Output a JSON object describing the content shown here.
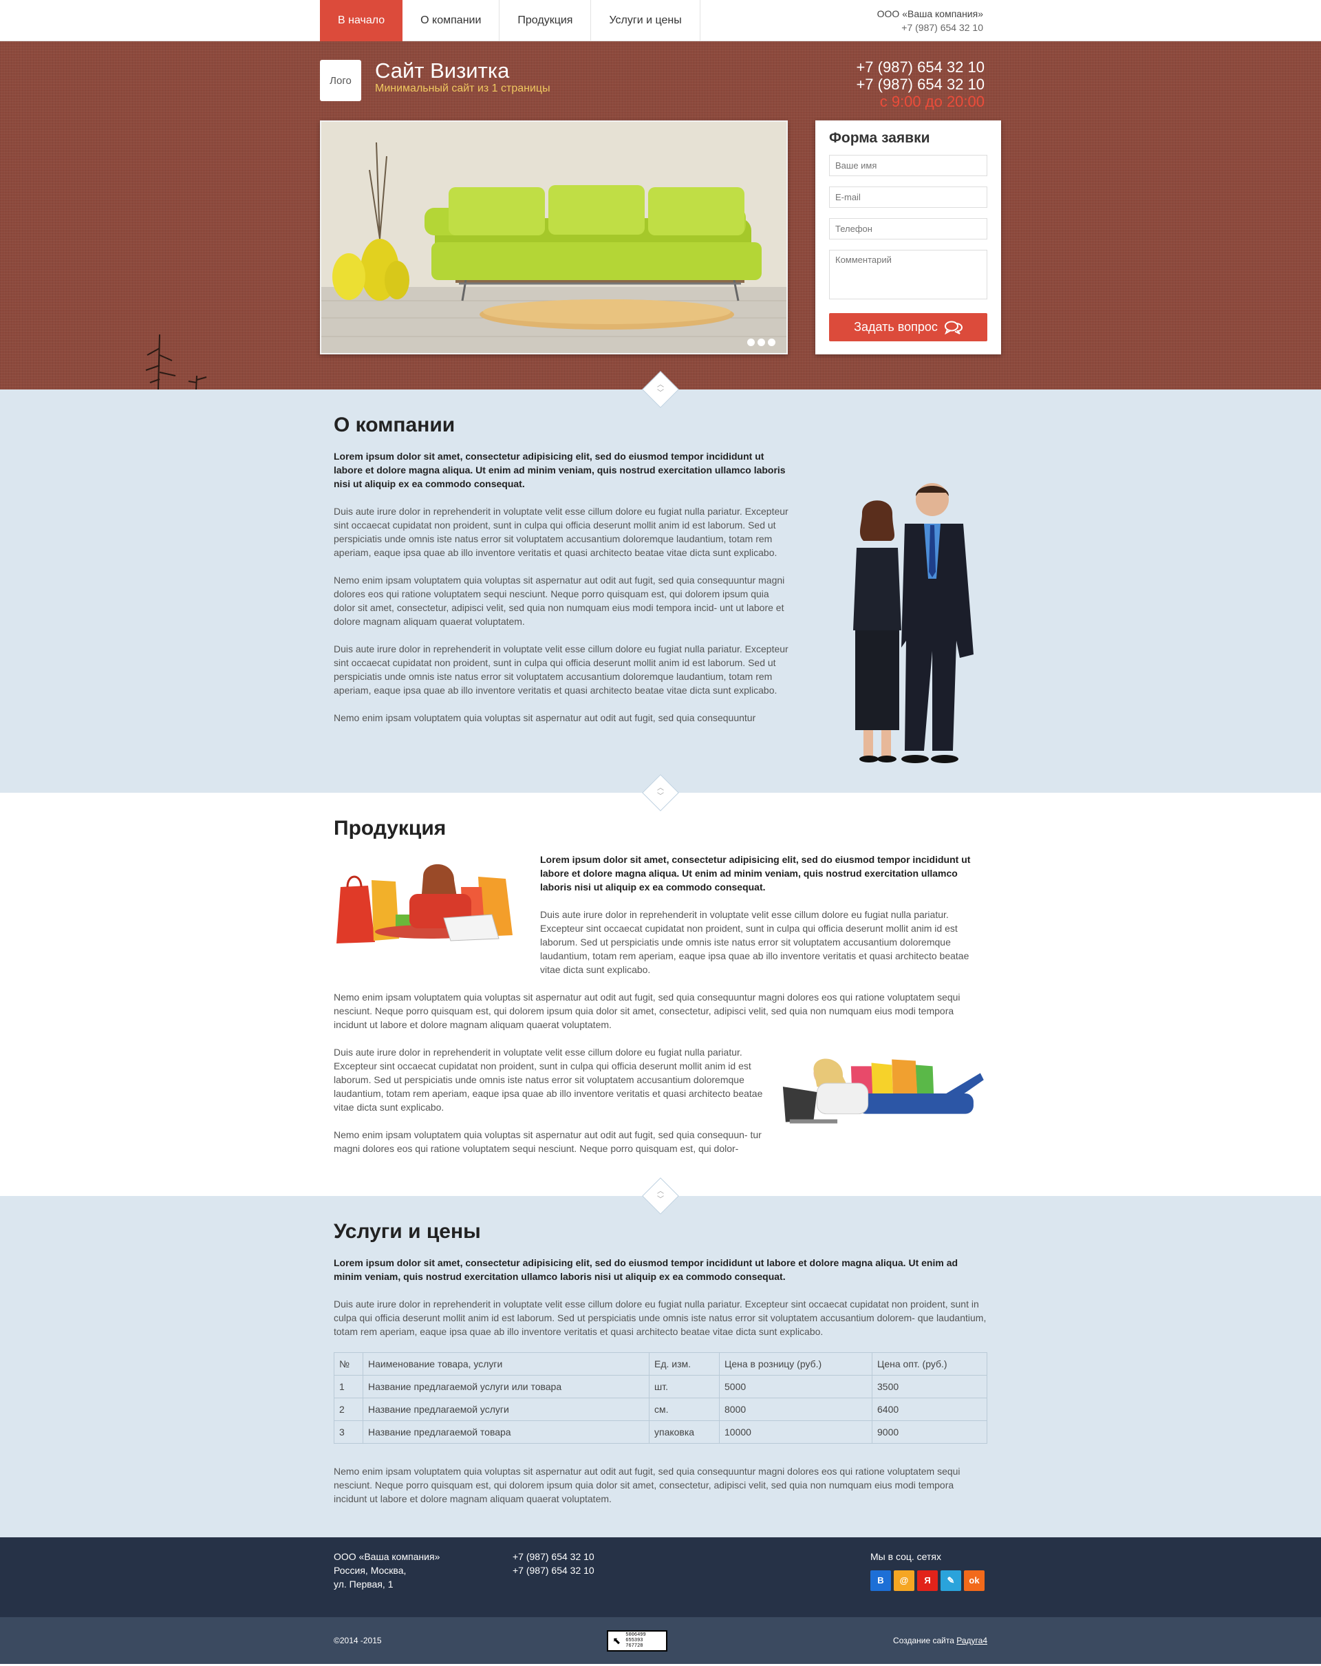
{
  "nav": {
    "items": [
      "В начало",
      "О компании",
      "Продукция",
      "Услуги и цены"
    ],
    "company": "ООО «Ваша компания»",
    "phone": "+7 (987) 654 32 10"
  },
  "hero": {
    "logo": "Лого",
    "title": "Сайт Визитка",
    "subtitle": "Минимальный сайт из 1 страницы",
    "phone1": "+7 (987) 654 32 10",
    "phone2": "+7 (987) 654 32 10",
    "hours": "с 9:00 до 20:00",
    "slider_dots": 3
  },
  "form": {
    "title": "Форма заявки",
    "name_placeholder": "Ваше имя",
    "email_placeholder": "E-mail",
    "phone_placeholder": "Телефон",
    "comment_placeholder": "Комментарий",
    "submit": "Задать вопрос"
  },
  "about": {
    "title": "О компании",
    "lead": "Lorem ipsum dolor sit amet, consectetur adipisicing elit, sed do eiusmod tempor incididunt ut labore et dolore magna aliqua. Ut enim ad minim veniam, quis nostrud exercitation ullamco laboris nisi ut aliquip ex ea commodo consequat.",
    "p1": "Duis aute irure dolor in reprehenderit in voluptate velit esse cillum dolore eu fugiat nulla pariatur. Excepteur sint occaecat cupidatat non proident, sunt in culpa qui officia deserunt mollit anim id est laborum. Sed ut perspiciatis unde omnis iste natus error sit voluptatem accusantium doloremque laudantium, totam rem aperiam, eaque ipsa quae ab illo inventore veritatis et quasi architecto beatae vitae dicta sunt explicabo.",
    "p2": "Nemo enim ipsam voluptatem quia voluptas sit aspernatur aut odit aut fugit, sed quia consequuntur magni dolores eos qui ratione voluptatem sequi nesciunt. Neque porro quisquam est, qui dolorem ipsum quia dolor sit amet, consectetur, adipisci velit, sed quia non numquam eius modi tempora incid- unt ut labore et dolore magnam aliquam quaerat voluptatem.",
    "p3": "Duis aute irure dolor in reprehenderit in voluptate velit esse cillum dolore eu fugiat nulla pariatur. Excepteur sint occaecat cupidatat non proident, sunt in culpa qui officia deserunt mollit anim id est laborum. Sed ut perspiciatis unde omnis iste natus error sit voluptatem accusantium doloremque laudantium, totam rem aperiam, eaque ipsa quae ab illo inventore veritatis et quasi architecto beatae vitae dicta sunt explicabo.",
    "p4": "Nemo enim ipsam voluptatem quia voluptas sit aspernatur aut odit aut fugit, sed quia consequuntur"
  },
  "products": {
    "title": "Продукция",
    "lead": "Lorem ipsum dolor sit amet, consectetur adipisicing elit, sed do eiusmod tempor incididunt ut labore et dolore magna aliqua. Ut enim ad minim veniam, quis nostrud exercitation ullamco laboris nisi ut aliquip ex ea commodo consequat.",
    "p1": "Duis aute irure dolor in reprehenderit in voluptate velit esse cillum dolore eu fugiat nulla pariatur. Excepteur sint occaecat cupidatat non proident, sunt in culpa qui officia deserunt mollit anim id est laborum. Sed ut perspiciatis unde omnis iste natus error sit voluptatem accusantium doloremque laudantium, totam rem aperiam, eaque ipsa quae ab illo inventore veritatis et quasi architecto beatae vitae dicta sunt explicabo.",
    "p2": "Nemo enim ipsam voluptatem quia voluptas sit aspernatur aut odit aut fugit, sed quia consequuntur magni dolores eos qui ratione voluptatem sequi nesciunt. Neque porro quisquam est, qui dolorem ipsum quia dolor sit amet, consectetur, adipisci velit, sed quia non numquam eius modi tempora incidunt ut labore et dolore magnam aliquam quaerat voluptatem.",
    "p3": "Duis aute irure dolor in reprehenderit in voluptate velit esse cillum dolore eu fugiat nulla pariatur. Excepteur sint occaecat cupidatat non proident, sunt in culpa qui officia deserunt mollit anim id est laborum. Sed ut perspiciatis unde omnis iste natus error sit voluptatem accusantium doloremque laudantium, totam rem aperiam, eaque ipsa quae ab illo inventore veritatis et quasi architecto beatae vitae dicta sunt explicabo.",
    "p4": "Nemo enim ipsam voluptatem quia voluptas sit aspernatur aut odit aut fugit, sed quia consequun- tur magni dolores eos qui ratione voluptatem sequi nesciunt. Neque porro quisquam est, qui dolor-"
  },
  "services": {
    "title": "Услуги и цены",
    "lead": "Lorem ipsum dolor sit amet, consectetur adipisicing elit, sed do eiusmod tempor incididunt ut labore et dolore magna aliqua. Ut enim ad minim veniam, quis nostrud exercitation ullamco laboris nisi ut aliquip ex ea commodo consequat.",
    "p1": "Duis aute irure dolor in reprehenderit in voluptate velit esse cillum dolore eu fugiat nulla pariatur. Excepteur sint occaecat cupidatat non proident, sunt in culpa qui officia deserunt mollit anim id est laborum. Sed ut perspiciatis unde omnis iste natus error sit voluptatem accusantium dolorem- que laudantium, totam rem aperiam, eaque ipsa quae ab illo inventore veritatis et quasi architecto beatae vitae dicta sunt explicabo.",
    "table": {
      "headers": [
        "№",
        "Наименование товара, услуги",
        "Ед. изм.",
        "Цена в розницу (руб.)",
        "Цена опт. (руб.)"
      ],
      "rows": [
        [
          "1",
          "Название предлагаемой услуги или товара",
          "шт.",
          "5000",
          "3500"
        ],
        [
          "2",
          "Название предлагаемой услуги",
          "см.",
          "8000",
          "6400"
        ],
        [
          "3",
          "Название предлагаемой товара",
          "упаковка",
          "10000",
          "9000"
        ]
      ]
    },
    "p2": "Nemo enim ipsam voluptatem quia voluptas sit aspernatur aut odit aut fugit, sed quia consequuntur magni dolores eos qui ratione voluptatem sequi nesciunt. Neque porro quisquam est, qui dolorem ipsum quia dolor sit amet, consectetur, adipisci velit, sed quia non numquam eius modi tempora incidunt ut labore et dolore magnam aliquam quaerat voluptatem."
  },
  "footer": {
    "company": "ООО «Ваша компания»",
    "city": "Россия, Москва,",
    "street": "ул. Первая, 1",
    "phone1": "+7 (987) 654 32 10",
    "phone2": "+7 (987) 654 32 10",
    "social_title": "Мы в соц. сетях",
    "socials": [
      {
        "name": "vk",
        "glyph": "В",
        "color": "#1d6fd6"
      },
      {
        "name": "moimir",
        "glyph": "@",
        "color": "#f5a623"
      },
      {
        "name": "yandex",
        "glyph": "Я",
        "color": "#e2231a"
      },
      {
        "name": "livejournal",
        "glyph": "✎",
        "color": "#2aa3db"
      },
      {
        "name": "odnoklassniki",
        "glyph": "ok",
        "color": "#f26a1b"
      }
    ],
    "copyright": "©2014 -2015",
    "counter_text": [
      "5006499",
      "655393",
      "767728"
    ],
    "made_label": "Создание сайта",
    "made_link": "Радуга4"
  },
  "colors": {
    "accent": "#dc4b3b",
    "hero_bg": "#8d4a3d",
    "section_blue": "#dbe6ef",
    "footer_dark": "#263247",
    "footer_bottom": "#3b4a60"
  }
}
